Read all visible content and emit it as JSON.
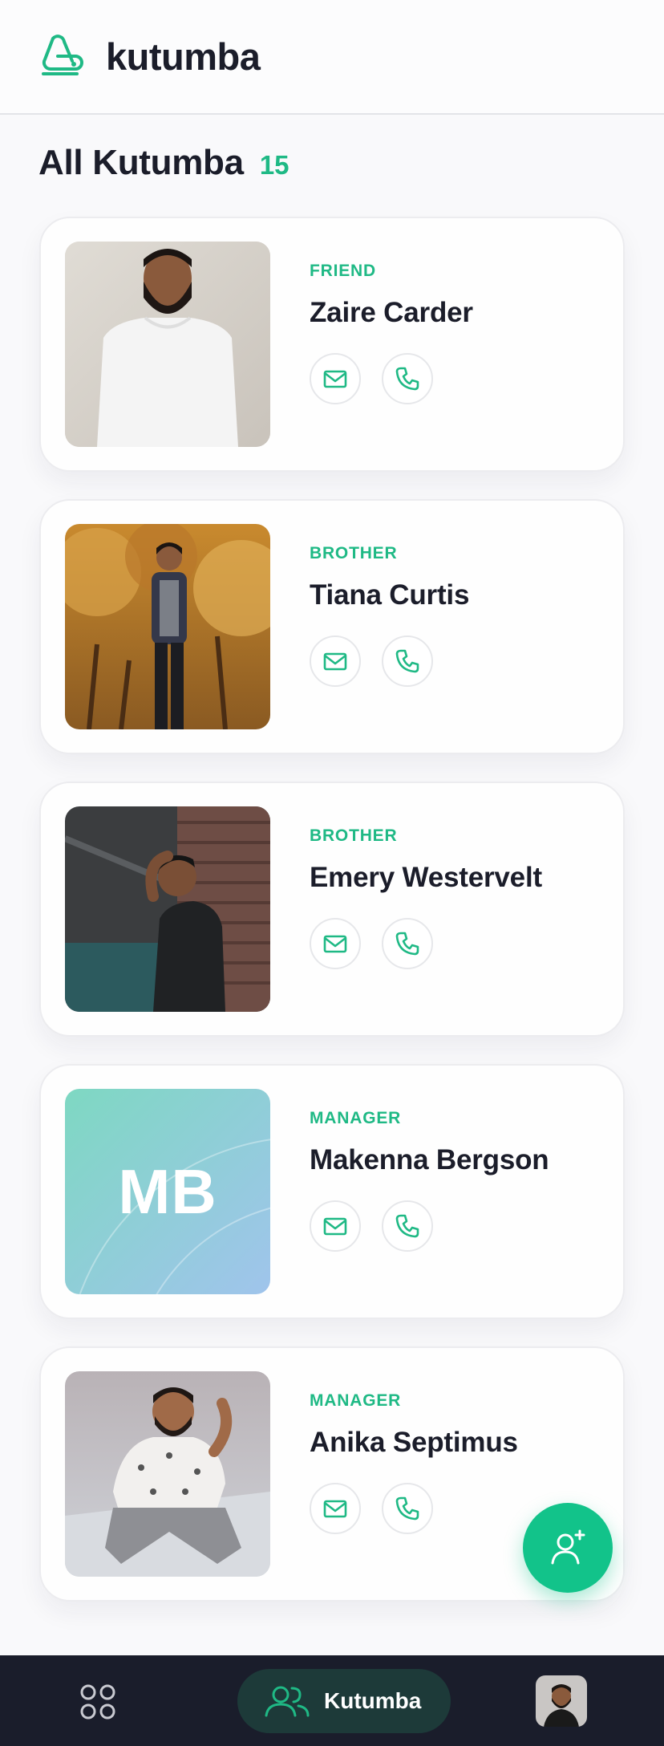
{
  "app": {
    "brand": "kutumba",
    "accent": "#1fb985",
    "logo_icon": "kutumba-logo-icon"
  },
  "list": {
    "title": "All Kutumba",
    "count": "15"
  },
  "contacts": [
    {
      "relation": "FRIEND",
      "name": "Zaire Carder",
      "avatar": "photo"
    },
    {
      "relation": "BROTHER",
      "name": "Tiana Curtis",
      "avatar": "photo"
    },
    {
      "relation": "BROTHER",
      "name": "Emery Westervelt",
      "avatar": "photo"
    },
    {
      "relation": "MANAGER",
      "name": "Makenna Bergson",
      "avatar": "initials",
      "initials": "MB"
    },
    {
      "relation": "MANAGER",
      "name": "Anika Septimus",
      "avatar": "photo"
    }
  ],
  "actions": {
    "mail_icon": "mail-icon",
    "phone_icon": "phone-icon",
    "fab_icon": "add-user-icon"
  },
  "nav": {
    "home_icon": "grid-icon",
    "active_label": "Kutumba",
    "active_icon": "users-icon",
    "profile_icon": "avatar"
  }
}
